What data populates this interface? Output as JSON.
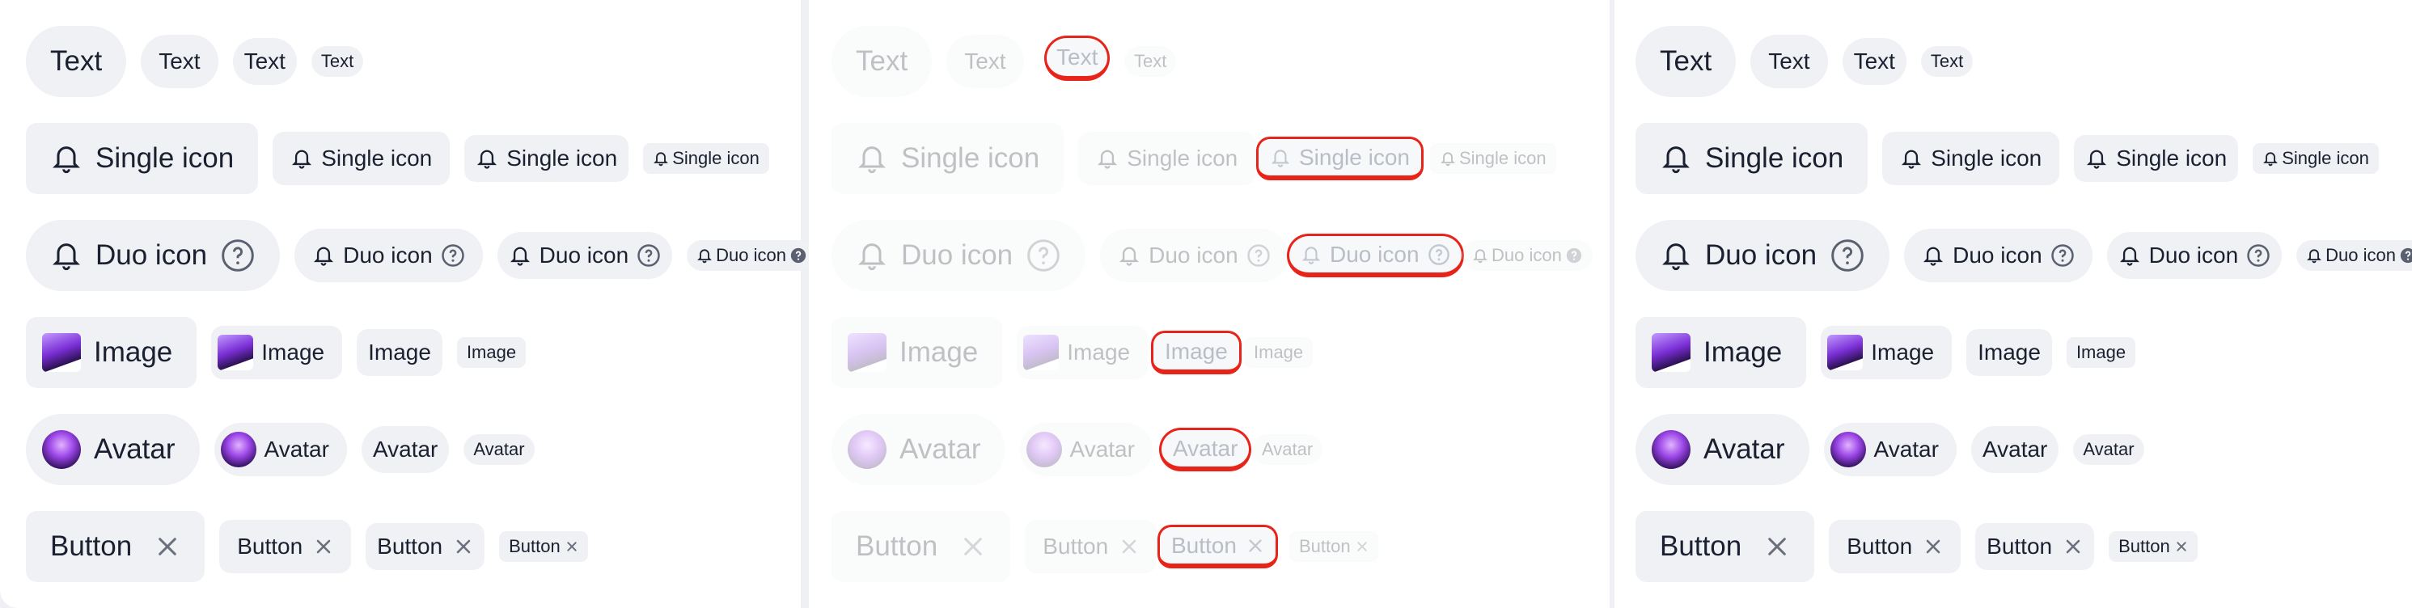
{
  "colors": {
    "accent_highlight": "#e8241a",
    "tag_bg": "#eff1f4",
    "text": "#1a2030"
  },
  "icons": [
    "bell-icon",
    "help-circle-icon",
    "close-icon"
  ],
  "panels": [
    {
      "rows": [
        {
          "label": "Text"
        },
        {
          "label": "Single icon"
        },
        {
          "label": "Duo icon"
        },
        {
          "label": "Image"
        },
        {
          "label": "Avatar"
        },
        {
          "label": "Button"
        }
      ]
    }
  ]
}
